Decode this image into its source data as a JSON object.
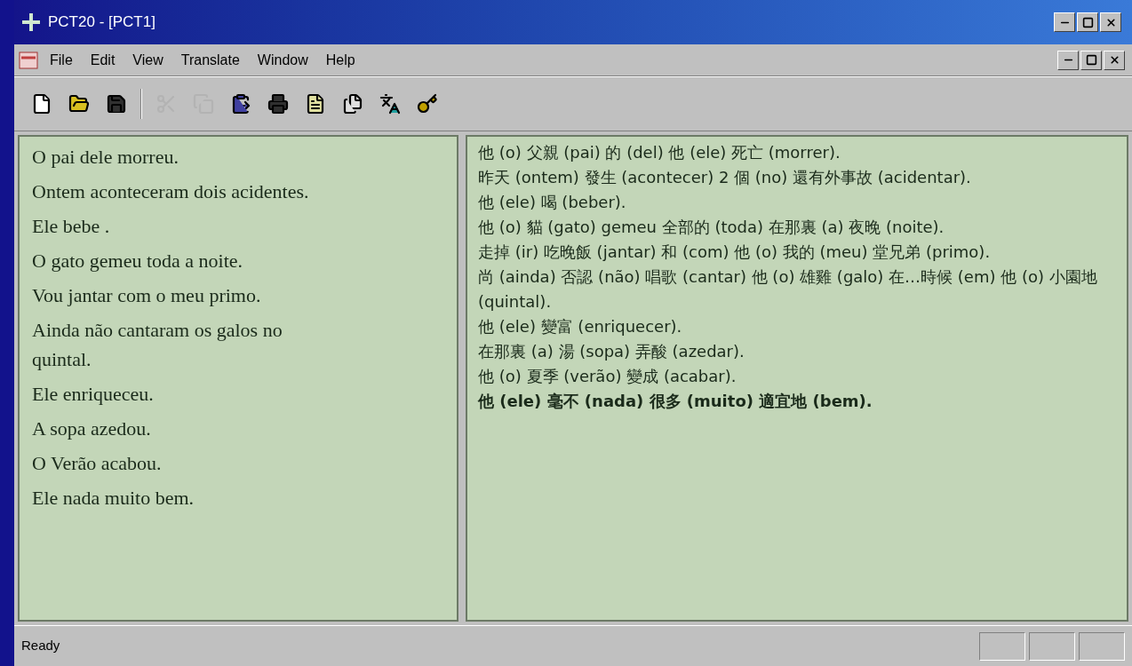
{
  "window": {
    "title": "PCT20 - [PCT1]"
  },
  "menu": [
    "File",
    "Edit",
    "View",
    "Translate",
    "Window",
    "Help"
  ],
  "toolbar": [
    {
      "kind": "new",
      "disabled": false
    },
    {
      "kind": "open",
      "disabled": false
    },
    {
      "kind": "save",
      "disabled": false
    },
    {
      "kind": "separator"
    },
    {
      "kind": "cut",
      "disabled": true
    },
    {
      "kind": "copy",
      "disabled": true
    },
    {
      "kind": "paste",
      "disabled": false
    },
    {
      "kind": "print",
      "disabled": false
    },
    {
      "kind": "document",
      "disabled": false
    },
    {
      "kind": "pages",
      "disabled": false
    },
    {
      "kind": "translate",
      "disabled": false
    },
    {
      "kind": "help",
      "disabled": false
    }
  ],
  "source_pane": {
    "lines": [
      "O pai dele morreu.",
      "Ontem aconteceram dois acidentes.",
      "Ele bebe .",
      "O gato gemeu toda a noite.",
      "Vou jantar com o meu primo.",
      "Ainda não cantaram os galos no quintal.",
      "Ele enriqueceu.",
      "A sopa azedou.",
      "O Verão acabou.",
      "Ele nada muito bem."
    ]
  },
  "translation_pane": {
    "lines": [
      {
        "text": "他 (o) 父親 (pai) 的 (del) 他 (ele) 死亡 (morrer).",
        "bold": false
      },
      {
        "text": "昨天 (ontem) 發生 (acontecer) 2 個 (no) 還有外事故 (acidentar).",
        "bold": false
      },
      {
        "text": "他 (ele) 喝 (beber).",
        "bold": false
      },
      {
        "text": "他 (o) 貓 (gato) gemeu 全部的 (toda) 在那裏 (a) 夜晚 (noite).",
        "bold": false
      },
      {
        "text": "走掉 (ir) 吃晚飯 (jantar) 和 (com) 他 (o) 我的 (meu) 堂兄弟 (primo).",
        "bold": false
      },
      {
        "text": "尚 (ainda) 否認 (não) 唱歌 (cantar) 他 (o) 雄雞 (galo) 在…時候 (em) 他 (o) 小園地 (quintal).",
        "bold": false
      },
      {
        "text": "他 (ele) 變富 (enriquecer).",
        "bold": false
      },
      {
        "text": "在那裏 (a) 湯 (sopa) 弄酸 (azedar).",
        "bold": false
      },
      {
        "text": "他 (o) 夏季 (verão) 變成 (acabar).",
        "bold": false
      },
      {
        "text": "他 (ele) 毫不 (nada) 很多 (muito) 適宜地 (bem).",
        "bold": true
      }
    ]
  },
  "status_bar": {
    "text": "Ready"
  }
}
